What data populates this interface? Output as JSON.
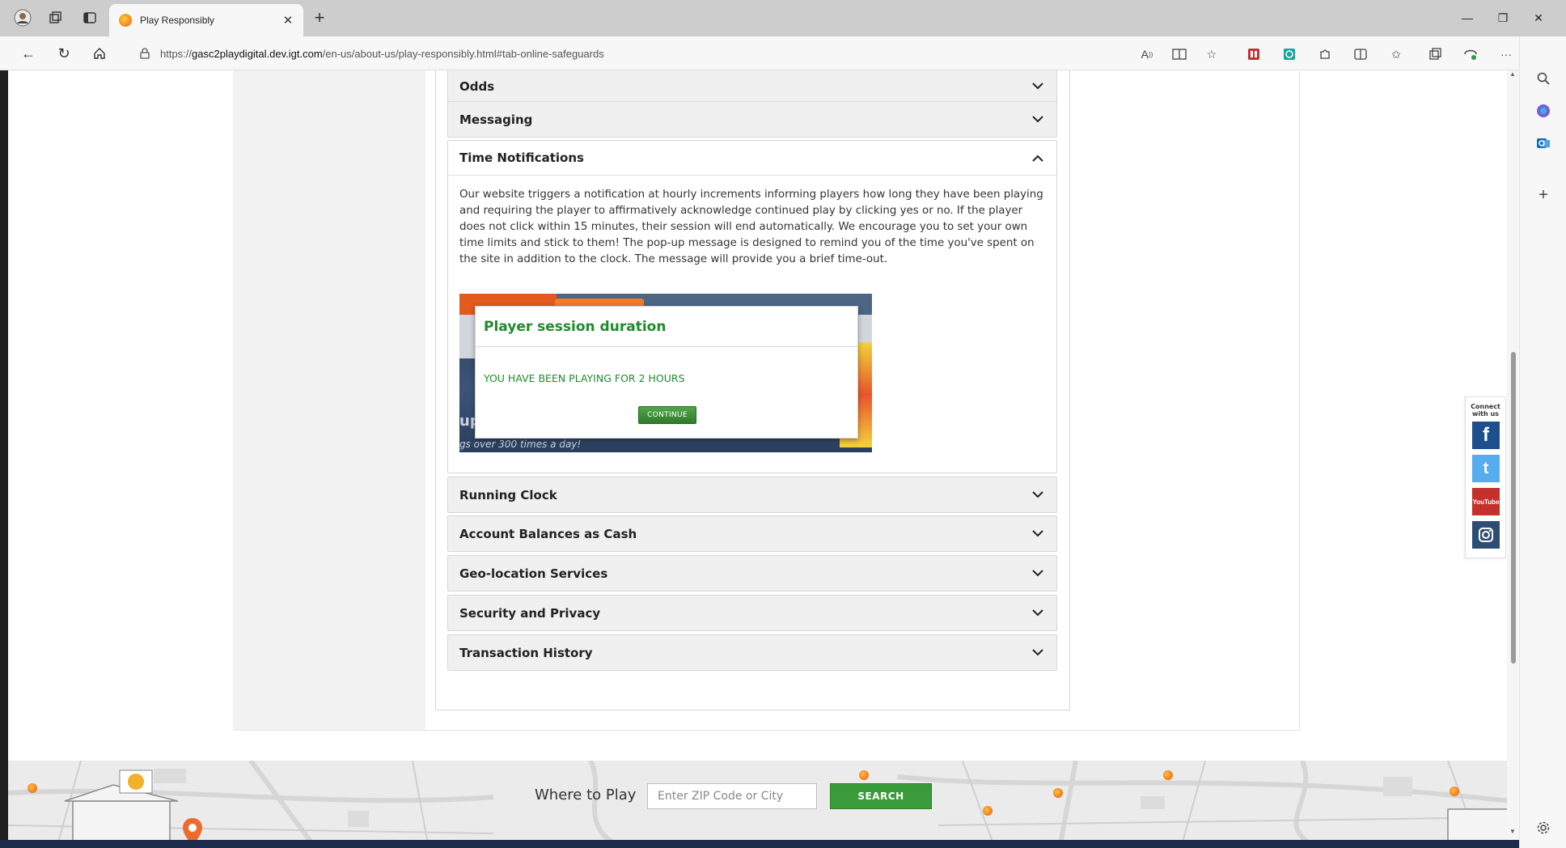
{
  "browser": {
    "tab_title": "Play Responsibly",
    "url_prefix": "https://",
    "url_domain": "gasc2playdigital.dev.igt.com",
    "url_path": "/en-us/about-us/play-responsibly.html#tab-online-safeguards"
  },
  "accordion": {
    "odds": "Odds",
    "messaging": "Messaging",
    "time_notifications": {
      "title": "Time Notifications",
      "body": "Our website triggers a notification at hourly increments informing players how long they have been playing and requiring the player to affirmatively acknowledge continued play by clicking yes or no. If the player does not click within 15 minutes, their session will end automatically. We encourage you to set your own time limits and stick to them! The pop-up message is designed to remind you of the time you've spent on the site in addition to the clock. The message will provide you a brief time-out."
    },
    "running_clock": "Running Clock",
    "account_balances": "Account Balances as Cash",
    "geolocation": "Geo-location Services",
    "security": "Security and Privacy",
    "transaction_history": "Transaction History"
  },
  "screenshot": {
    "modal_title": "Player session duration",
    "modal_message": "YOU HAVE BEEN PLAYING FOR 2 HOURS",
    "continue_label": "CONTINUE",
    "bg_text_large": "up",
    "bg_text_small": "gs over 300 times a day!"
  },
  "footer": {
    "where_to_play": "Where to Play",
    "zip_placeholder": "Enter ZIP Code or City",
    "search_label": "SEARCH"
  },
  "social": {
    "label": "Connect with us",
    "youtube_text": "YouTube"
  },
  "colors": {
    "green_accent": "#1f8a2e",
    "facebook": "#1d4f8f",
    "twitter": "#55acee",
    "youtube": "#c4302b",
    "instagram": "#2c4e73"
  }
}
